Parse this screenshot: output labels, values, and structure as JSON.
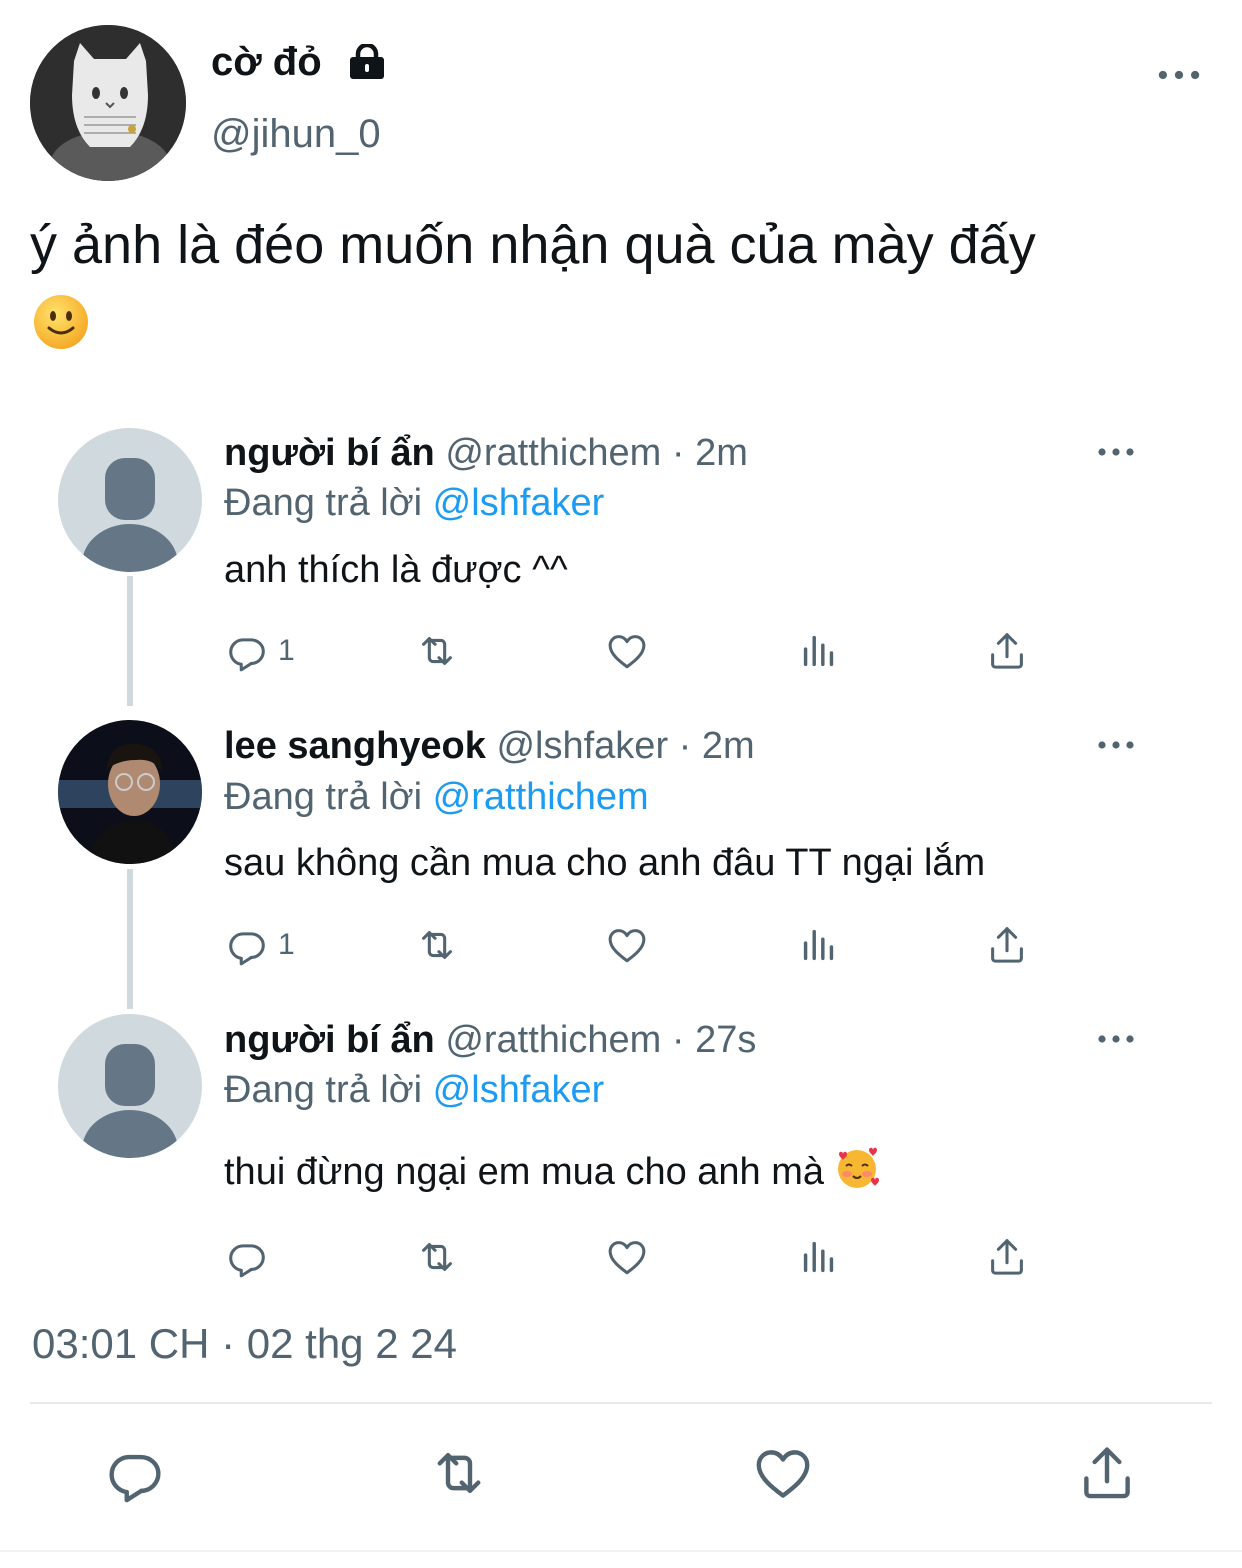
{
  "tweet": {
    "author_name": "cờ đỏ",
    "author_handle": "@jihun_0",
    "text": "ý ảnh là đéo muốn nhận quà của mày đấy",
    "timestamp": "03:01 CH · 02 thg 2 24"
  },
  "replies": [
    {
      "name": "người bí ẩn",
      "handle": "@ratthichem",
      "dot": "·",
      "time": "2m",
      "replying_prefix": "Đang trả lời",
      "replying_to": "@lshfaker",
      "text": "anh thích là được ^^",
      "reply_count": "1"
    },
    {
      "name": "lee sanghyeok",
      "handle": "@lshfaker",
      "dot": "·",
      "time": "2m",
      "replying_prefix": "Đang trả lời",
      "replying_to": "@ratthichem",
      "text": "sau không cần mua cho anh đâu TT ngại lắm",
      "reply_count": "1"
    },
    {
      "name": "người bí ẩn",
      "handle": "@ratthichem",
      "dot": "·",
      "time": "27s",
      "replying_prefix": "Đang trả lời",
      "replying_to": "@lshfaker",
      "text": "thui đừng ngại em mua cho anh mà",
      "reply_count": ""
    }
  ],
  "colors": {
    "link": "#1d9bf0",
    "secondary_text": "#536471",
    "thread_line": "#cfd9de"
  },
  "icons": [
    "lock-icon",
    "more-icon",
    "reply-icon",
    "retweet-icon",
    "like-icon",
    "views-icon",
    "share-icon",
    "smile-emoji-icon",
    "hearts-emoji-icon"
  ]
}
